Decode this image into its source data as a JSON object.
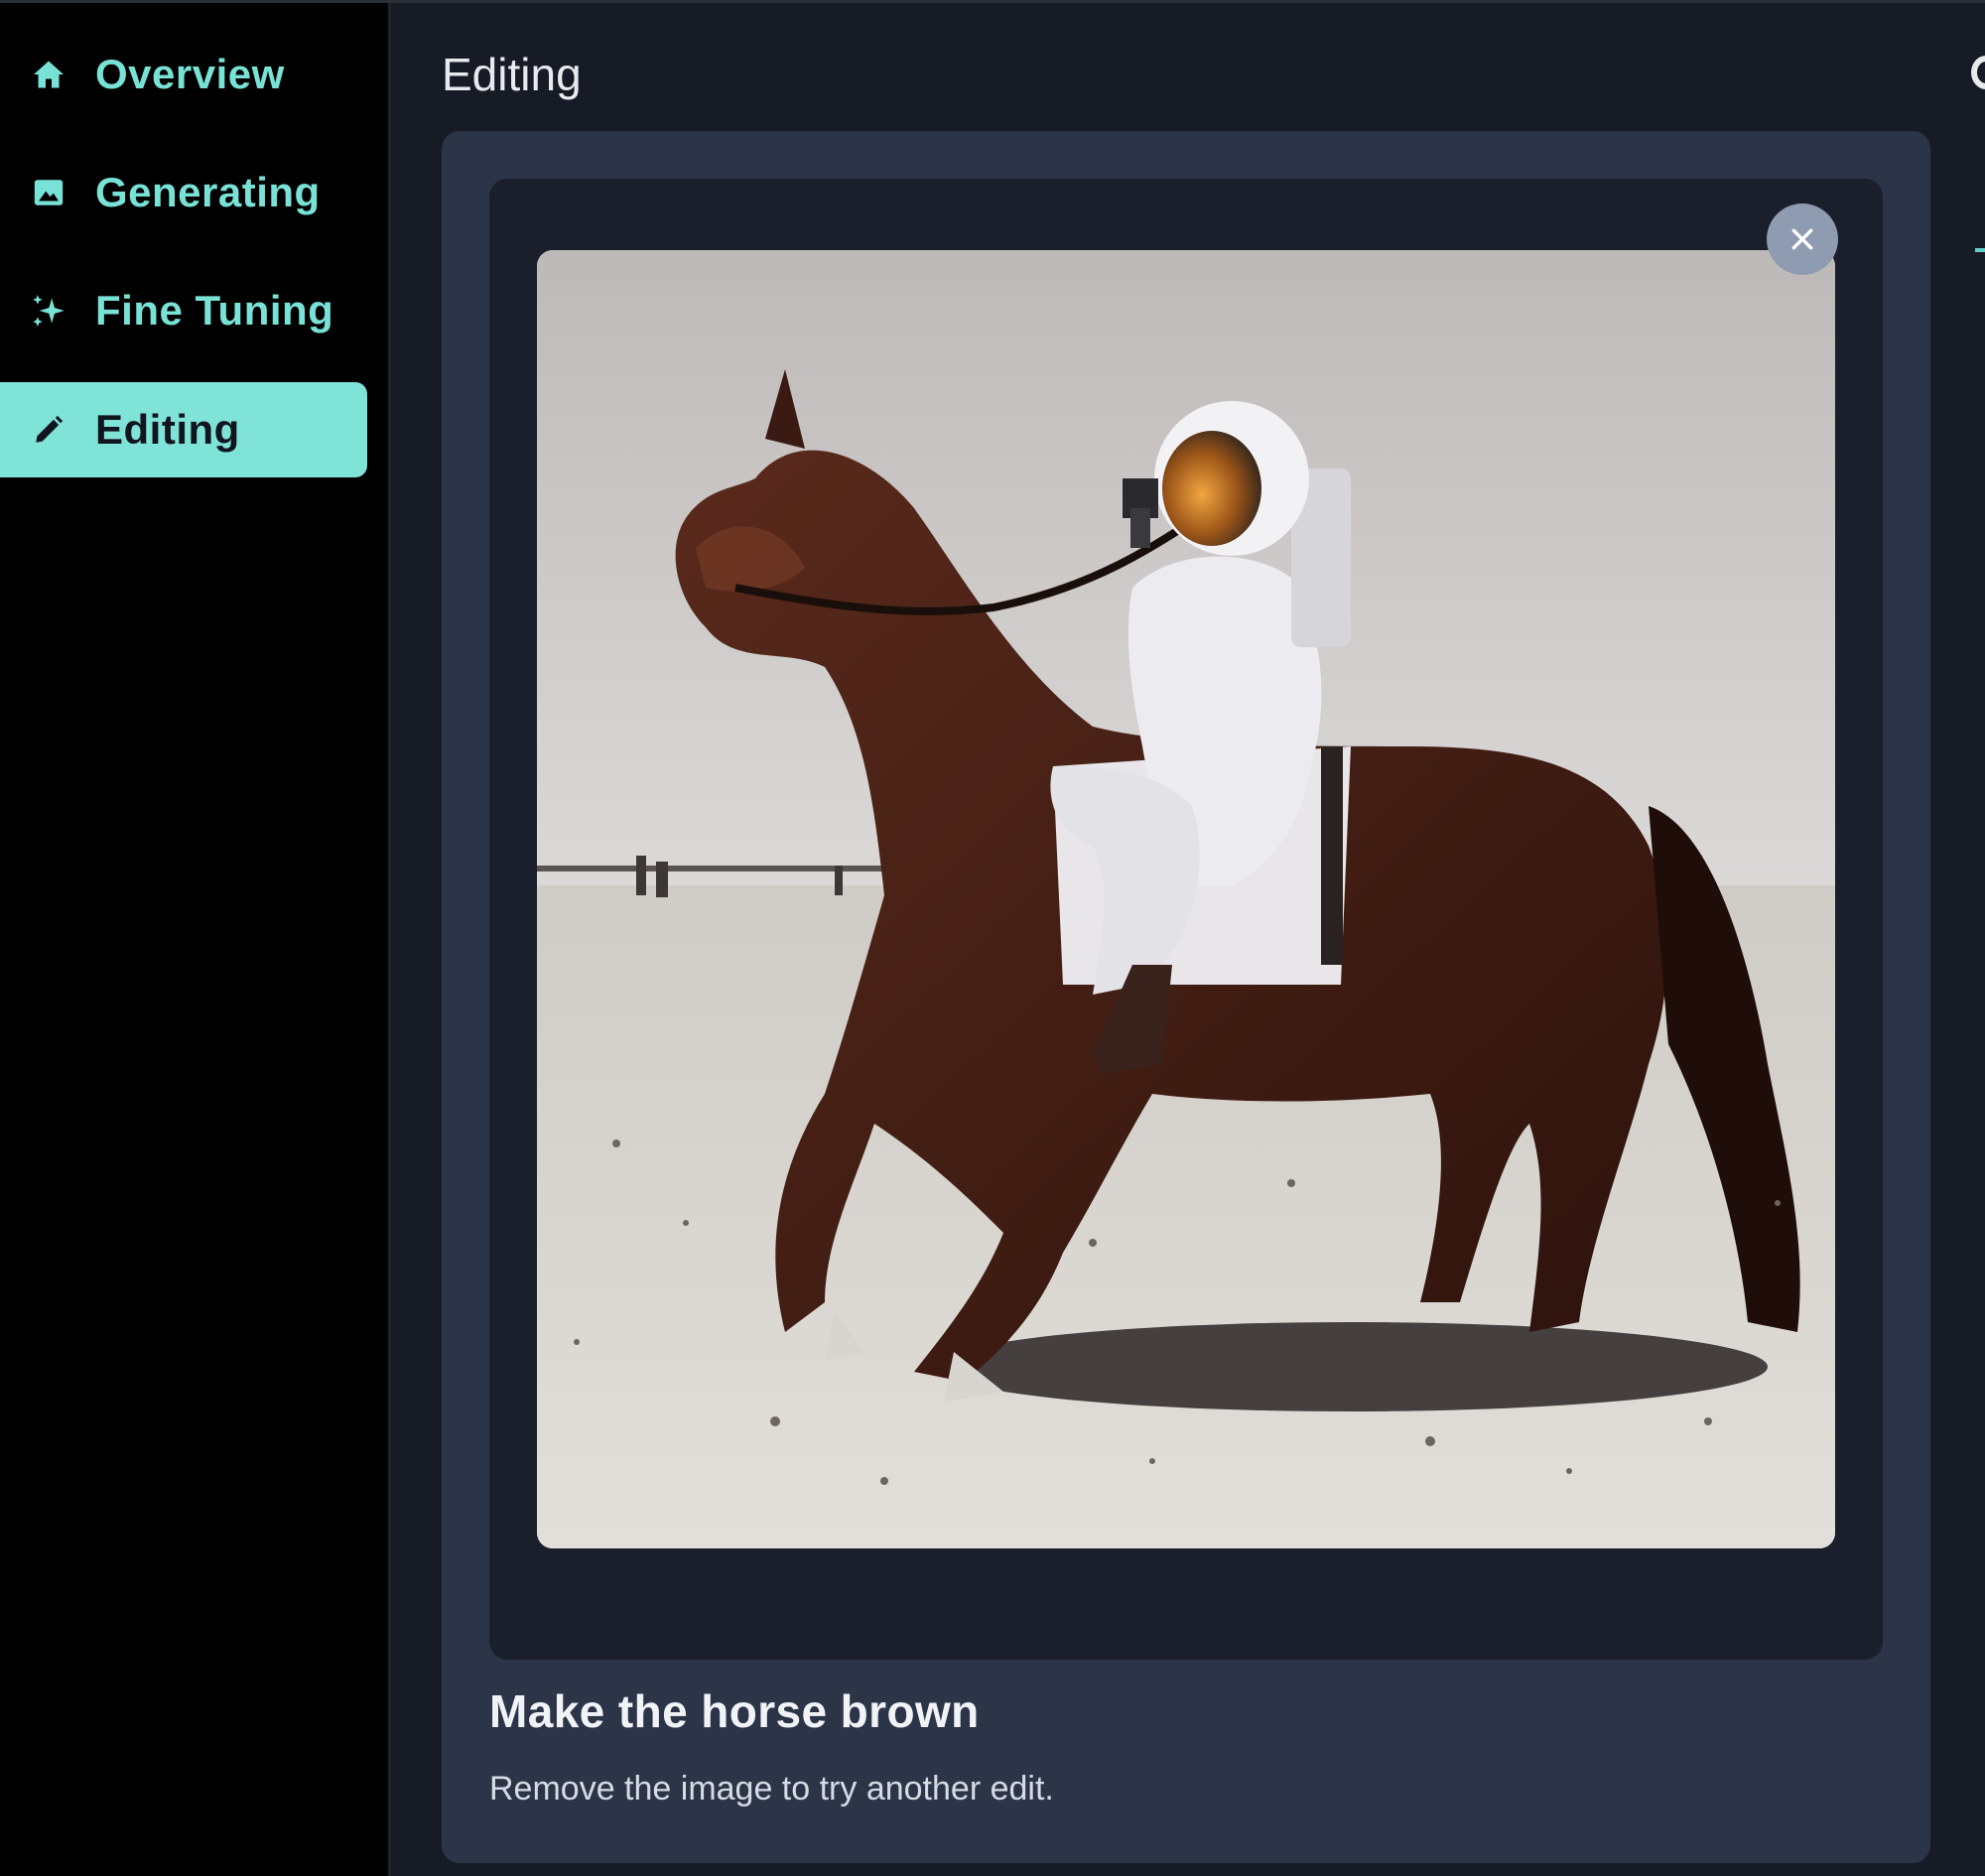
{
  "sidebar": {
    "items": [
      {
        "label": "Overview",
        "icon": "home-icon"
      },
      {
        "label": "Generating",
        "icon": "image-icon"
      },
      {
        "label": "Fine Tuning",
        "icon": "sparkles-icon"
      },
      {
        "label": "Editing",
        "icon": "pencil-icon",
        "active": true
      }
    ]
  },
  "header": {
    "title": "Editing"
  },
  "editor": {
    "image_alt": "Astronaut riding a brown horse in a desert",
    "close_icon": "close-icon",
    "prompt_title": "Make the horse brown",
    "prompt_subtitle": "Remove the image to try another edit."
  },
  "colors": {
    "accent": "#79e2d6",
    "active_bg": "#7fe3d8",
    "sidebar_bg": "#000000",
    "main_bg": "#171b26",
    "card_bg": "#2c3548",
    "frame_bg": "#1a1f2b"
  }
}
